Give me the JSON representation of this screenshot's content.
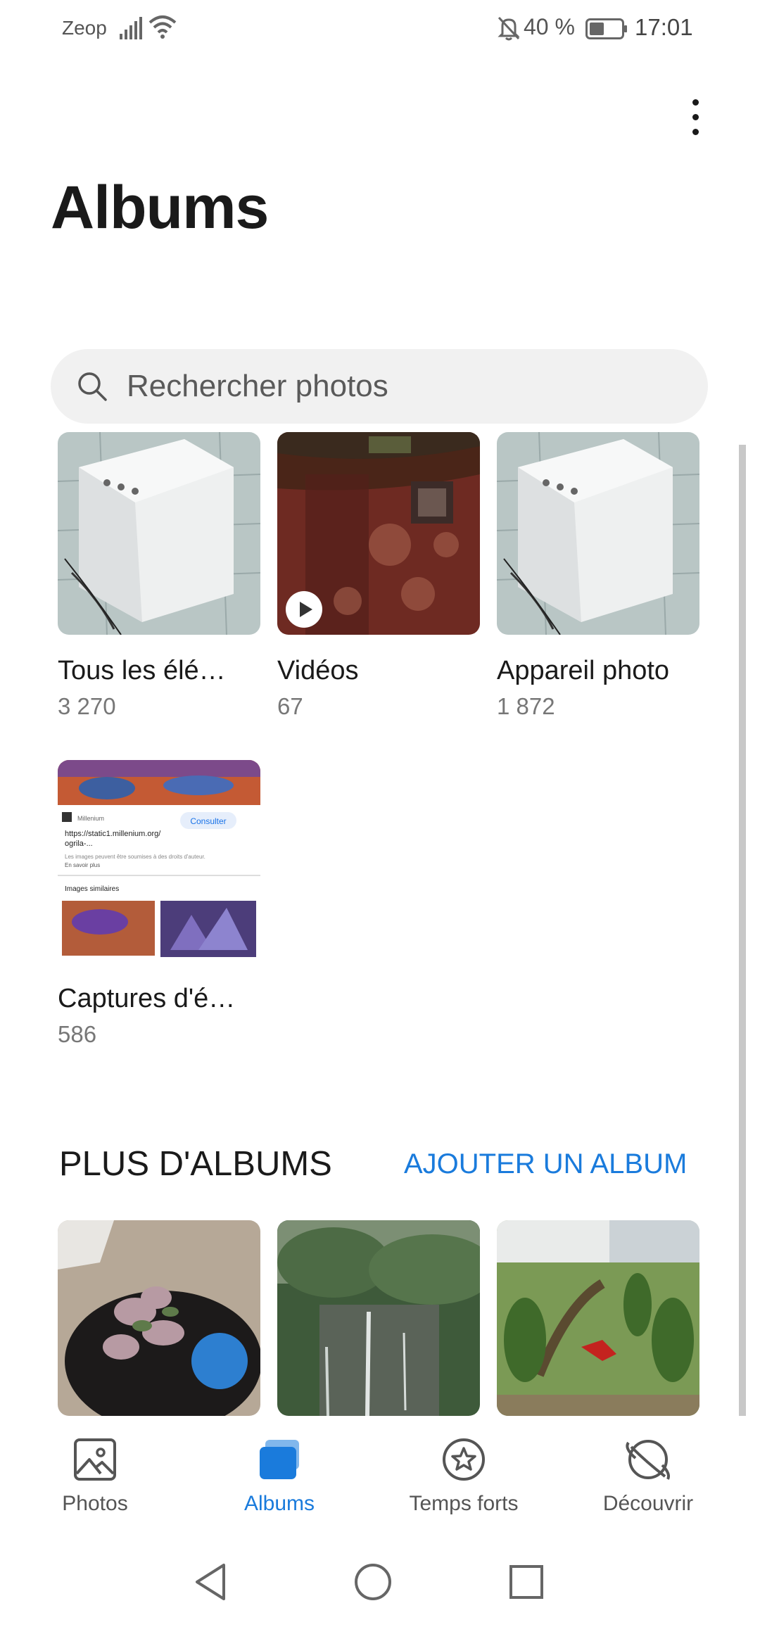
{
  "status_bar": {
    "carrier": "Zeop",
    "battery_percent": "40 %",
    "time": "17:01",
    "icons": [
      "signal-icon",
      "wifi-icon",
      "mute-icon",
      "battery-icon"
    ]
  },
  "header": {
    "title": "Albums",
    "menu_icon": "more-vertical-icon"
  },
  "search": {
    "placeholder": "Rechercher photos"
  },
  "albums": [
    {
      "name": "Tous les élé…",
      "count": "3 270"
    },
    {
      "name": "Vidéos",
      "count": "67"
    },
    {
      "name": "Appareil photo",
      "count": "1 872"
    },
    {
      "name": "Captures d'é…",
      "count": "586"
    }
  ],
  "screenshot_thumb": {
    "site": "Millenium",
    "button": "Consulter",
    "url": "https://static1.millenium.org/",
    "url_cont": "ogrila-...",
    "note": "Les images peuvent être soumises à des droits d'auteur.",
    "note_link": "En savoir plus",
    "similar": "Images similaires"
  },
  "more_albums": {
    "title": "PLUS D'ALBUMS",
    "add_label": "AJOUTER UN ALBUM"
  },
  "bottom_nav": [
    {
      "label": "Photos",
      "icon": "image-icon",
      "active": false
    },
    {
      "label": "Albums",
      "icon": "albums-icon",
      "active": true
    },
    {
      "label": "Temps forts",
      "icon": "star-circle-icon",
      "active": false
    },
    {
      "label": "Découvrir",
      "icon": "planet-icon",
      "active": false
    }
  ],
  "colors": {
    "accent": "#1a7bdc",
    "text_primary": "#1a1a1a",
    "text_secondary": "#777777",
    "search_bg": "#f1f1f1"
  }
}
